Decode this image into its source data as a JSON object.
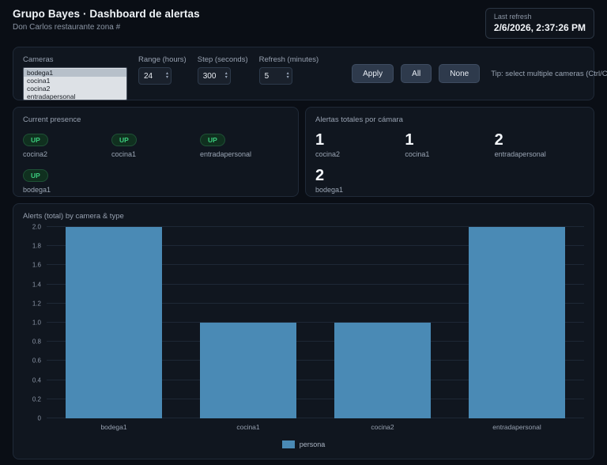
{
  "colors": {
    "bar": "#4a8ab5",
    "up_text": "#3bcd7d",
    "panel_bg": "#10161f",
    "page_bg": "#0a0e15"
  },
  "header": {
    "title": "Grupo Bayes · Dashboard de alertas",
    "subtitle": "Don Carlos restaurante zona #",
    "last_refresh_label": "Last refresh",
    "last_refresh_value": "2/6/2026, 2:37:26 PM"
  },
  "controls": {
    "cameras_label": "Cameras",
    "camera_options": [
      "bodega1",
      "cocina1",
      "cocina2",
      "entradapersonal"
    ],
    "range_label": "Range (hours)",
    "range_value": "24",
    "step_label": "Step (seconds)",
    "step_value": "300",
    "refresh_label": "Refresh (minutes)",
    "refresh_value": "5",
    "apply_label": "Apply",
    "all_label": "All",
    "none_label": "None",
    "tip": "Tip: select multiple cameras (Ctrl/Cmd + click)"
  },
  "presence": {
    "title": "Current presence",
    "items": [
      {
        "status": "UP",
        "camera": "cocina2"
      },
      {
        "status": "UP",
        "camera": "cocina1"
      },
      {
        "status": "UP",
        "camera": "entradapersonal"
      },
      {
        "status": "UP",
        "camera": "bodega1"
      }
    ]
  },
  "totals": {
    "title": "Alertas totales por cámara",
    "items": [
      {
        "count": "1",
        "camera": "cocina2"
      },
      {
        "count": "1",
        "camera": "cocina1"
      },
      {
        "count": "2",
        "camera": "entradapersonal"
      },
      {
        "count": "2",
        "camera": "bodega1"
      }
    ]
  },
  "chart_data": {
    "type": "bar",
    "title": "Alerts (total) by camera & type",
    "categories": [
      "bodega1",
      "cocina1",
      "cocina2",
      "entradapersonal"
    ],
    "series": [
      {
        "name": "persona",
        "values": [
          2,
          1,
          1,
          2
        ]
      }
    ],
    "xlabel": "",
    "ylabel": "",
    "ylim": [
      0,
      2
    ],
    "ytick_step": 0.2,
    "grid": true,
    "legend_position": "bottom",
    "bar_color": "#4a8ab5"
  }
}
